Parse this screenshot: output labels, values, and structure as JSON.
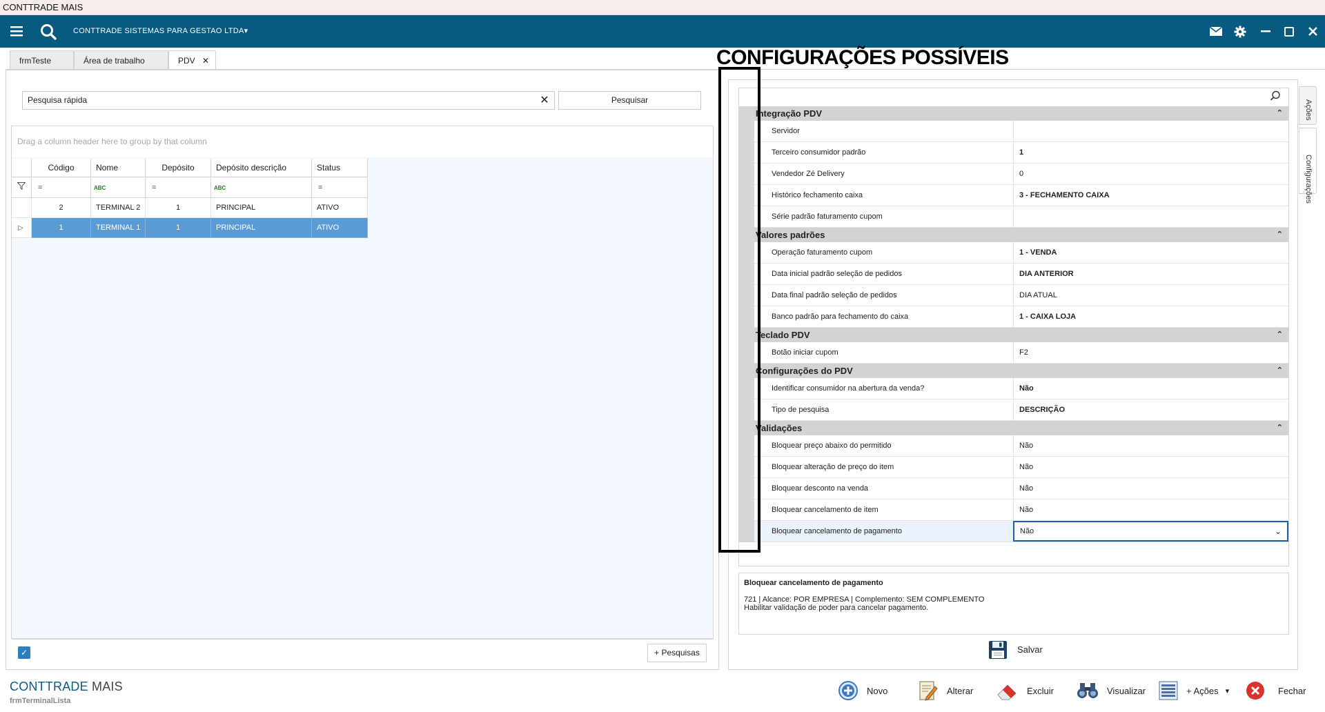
{
  "window": {
    "title": "CONTTRADE MAIS"
  },
  "nav": {
    "company": "CONTTRADE SISTEMAS PARA GESTAO LTDA",
    "caret": "▾"
  },
  "tabs": [
    {
      "label": "frmTeste"
    },
    {
      "label": "Área de trabalho"
    },
    {
      "label": "PDV",
      "close": "✕"
    }
  ],
  "left": {
    "search_placeholder": "Pesquisa rápida",
    "search_clear": "✕",
    "search_button": "Pesquisar",
    "group_hint": "Drag a column header here to group by that column",
    "columns": [
      "Código",
      "Nome",
      "Depósito",
      "Depósito descrição",
      "Status"
    ],
    "filter_eq": "=",
    "filter_abc": "ABC",
    "rows": [
      [
        "2",
        "TERMINAL 2",
        "1",
        "PRINCIPAL",
        "ATIVO"
      ],
      [
        "1",
        "TERMINAL 1",
        "1",
        "PRINCIPAL",
        "ATIVO"
      ]
    ],
    "row_indicator": "▷",
    "more_search": "+ Pesquisas"
  },
  "brand": {
    "part1": "CONTTRADE",
    "part2": " MAIS",
    "form": "frmTerminalLista"
  },
  "right": {
    "annotation_title": "CONFIGURAÇÕES POSSÍVEIS",
    "categories": [
      {
        "name": "Integração PDV",
        "rows": [
          {
            "label": "Servidor",
            "value": "",
            "bold": false
          },
          {
            "label": "Terceiro consumidor padrão",
            "value": "1",
            "bold": true
          },
          {
            "label": "Vendedor Zé Delivery",
            "value": "0",
            "bold": false
          },
          {
            "label": "Histórico fechamento caixa",
            "value": "3 - FECHAMENTO CAIXA",
            "bold": true
          },
          {
            "label": "Série padrão faturamento cupom",
            "value": "",
            "bold": false
          }
        ]
      },
      {
        "name": "Valores padrões",
        "rows": [
          {
            "label": "Operação faturamento cupom",
            "value": "1 - VENDA",
            "bold": true
          },
          {
            "label": "Data inicial padrão seleção de pedidos",
            "value": "DIA ANTERIOR",
            "bold": true
          },
          {
            "label": "Data final padrão seleção de pedidos",
            "value": "DIA ATUAL",
            "bold": false
          },
          {
            "label": "Banco padrão para fechamento do caixa",
            "value": "1 - CAIXA LOJA",
            "bold": true
          }
        ]
      },
      {
        "name": "Teclado PDV",
        "rows": [
          {
            "label": "Botão iniciar cupom",
            "value": "F2",
            "bold": false
          }
        ]
      },
      {
        "name": "Configurações do PDV",
        "rows": [
          {
            "label": "Identificar consumidor na abertura da venda?",
            "value": "Não",
            "bold": true
          },
          {
            "label": "Tipo de pesquisa",
            "value": "DESCRIÇÃO",
            "bold": true
          }
        ]
      },
      {
        "name": "Validações",
        "rows": [
          {
            "label": "Bloquear preço abaixo do permitido",
            "value": "Não",
            "bold": false
          },
          {
            "label": "Bloquear alteração de preço do item",
            "value": "Não",
            "bold": false
          },
          {
            "label": "Bloquear desconto na venda",
            "value": "Não",
            "bold": false
          },
          {
            "label": "Bloquear cancelamento de item",
            "value": "Não",
            "bold": false
          },
          {
            "label": "Bloquear cancelamento de pagamento",
            "value": "Não",
            "bold": false
          }
        ]
      }
    ],
    "chevron": "⌃",
    "dropdown": "⌄",
    "desc_title": "Bloquear cancelamento de pagamento",
    "desc_line1": "721 | Alcance: POR EMPRESA | Complemento: SEM COMPLEMENTO",
    "desc_line2": "Habilitar validação de poder para cancelar pagamento.",
    "save": "Salvar",
    "side_tabs": [
      "Ações",
      "Configurações"
    ]
  },
  "toolbar": {
    "novo": "Novo",
    "alterar": "Alterar",
    "excluir": "Excluir",
    "visualizar": "Visualizar",
    "mais_acoes": "+ Ações",
    "mais_acoes_caret": "▾",
    "fechar": "Fechar"
  },
  "colors": {
    "nav": "#075b80",
    "selection": "#5b9bd5",
    "brand": "#0a5a85"
  }
}
